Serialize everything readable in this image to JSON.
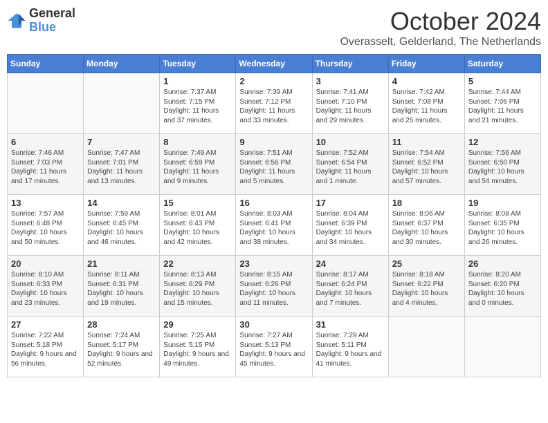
{
  "logo": {
    "general": "General",
    "blue": "Blue"
  },
  "title": "October 2024",
  "subtitle": "Overasselt, Gelderland, The Netherlands",
  "days_of_week": [
    "Sunday",
    "Monday",
    "Tuesday",
    "Wednesday",
    "Thursday",
    "Friday",
    "Saturday"
  ],
  "weeks": [
    [
      {
        "day": "",
        "content": ""
      },
      {
        "day": "",
        "content": ""
      },
      {
        "day": "1",
        "content": "Sunrise: 7:37 AM\nSunset: 7:15 PM\nDaylight: 11 hours and 37 minutes."
      },
      {
        "day": "2",
        "content": "Sunrise: 7:39 AM\nSunset: 7:12 PM\nDaylight: 11 hours and 33 minutes."
      },
      {
        "day": "3",
        "content": "Sunrise: 7:41 AM\nSunset: 7:10 PM\nDaylight: 11 hours and 29 minutes."
      },
      {
        "day": "4",
        "content": "Sunrise: 7:42 AM\nSunset: 7:08 PM\nDaylight: 11 hours and 25 minutes."
      },
      {
        "day": "5",
        "content": "Sunrise: 7:44 AM\nSunset: 7:06 PM\nDaylight: 11 hours and 21 minutes."
      }
    ],
    [
      {
        "day": "6",
        "content": "Sunrise: 7:46 AM\nSunset: 7:03 PM\nDaylight: 11 hours and 17 minutes."
      },
      {
        "day": "7",
        "content": "Sunrise: 7:47 AM\nSunset: 7:01 PM\nDaylight: 11 hours and 13 minutes."
      },
      {
        "day": "8",
        "content": "Sunrise: 7:49 AM\nSunset: 6:59 PM\nDaylight: 11 hours and 9 minutes."
      },
      {
        "day": "9",
        "content": "Sunrise: 7:51 AM\nSunset: 6:56 PM\nDaylight: 11 hours and 5 minutes."
      },
      {
        "day": "10",
        "content": "Sunrise: 7:52 AM\nSunset: 6:54 PM\nDaylight: 11 hours and 1 minute."
      },
      {
        "day": "11",
        "content": "Sunrise: 7:54 AM\nSunset: 6:52 PM\nDaylight: 10 hours and 57 minutes."
      },
      {
        "day": "12",
        "content": "Sunrise: 7:56 AM\nSunset: 6:50 PM\nDaylight: 10 hours and 54 minutes."
      }
    ],
    [
      {
        "day": "13",
        "content": "Sunrise: 7:57 AM\nSunset: 6:48 PM\nDaylight: 10 hours and 50 minutes."
      },
      {
        "day": "14",
        "content": "Sunrise: 7:59 AM\nSunset: 6:45 PM\nDaylight: 10 hours and 46 minutes."
      },
      {
        "day": "15",
        "content": "Sunrise: 8:01 AM\nSunset: 6:43 PM\nDaylight: 10 hours and 42 minutes."
      },
      {
        "day": "16",
        "content": "Sunrise: 8:03 AM\nSunset: 6:41 PM\nDaylight: 10 hours and 38 minutes."
      },
      {
        "day": "17",
        "content": "Sunrise: 8:04 AM\nSunset: 6:39 PM\nDaylight: 10 hours and 34 minutes."
      },
      {
        "day": "18",
        "content": "Sunrise: 8:06 AM\nSunset: 6:37 PM\nDaylight: 10 hours and 30 minutes."
      },
      {
        "day": "19",
        "content": "Sunrise: 8:08 AM\nSunset: 6:35 PM\nDaylight: 10 hours and 26 minutes."
      }
    ],
    [
      {
        "day": "20",
        "content": "Sunrise: 8:10 AM\nSunset: 6:33 PM\nDaylight: 10 hours and 23 minutes."
      },
      {
        "day": "21",
        "content": "Sunrise: 8:11 AM\nSunset: 6:31 PM\nDaylight: 10 hours and 19 minutes."
      },
      {
        "day": "22",
        "content": "Sunrise: 8:13 AM\nSunset: 6:29 PM\nDaylight: 10 hours and 15 minutes."
      },
      {
        "day": "23",
        "content": "Sunrise: 8:15 AM\nSunset: 6:26 PM\nDaylight: 10 hours and 11 minutes."
      },
      {
        "day": "24",
        "content": "Sunrise: 8:17 AM\nSunset: 6:24 PM\nDaylight: 10 hours and 7 minutes."
      },
      {
        "day": "25",
        "content": "Sunrise: 8:18 AM\nSunset: 6:22 PM\nDaylight: 10 hours and 4 minutes."
      },
      {
        "day": "26",
        "content": "Sunrise: 8:20 AM\nSunset: 6:20 PM\nDaylight: 10 hours and 0 minutes."
      }
    ],
    [
      {
        "day": "27",
        "content": "Sunrise: 7:22 AM\nSunset: 5:18 PM\nDaylight: 9 hours and 56 minutes."
      },
      {
        "day": "28",
        "content": "Sunrise: 7:24 AM\nSunset: 5:17 PM\nDaylight: 9 hours and 52 minutes."
      },
      {
        "day": "29",
        "content": "Sunrise: 7:25 AM\nSunset: 5:15 PM\nDaylight: 9 hours and 49 minutes."
      },
      {
        "day": "30",
        "content": "Sunrise: 7:27 AM\nSunset: 5:13 PM\nDaylight: 9 hours and 45 minutes."
      },
      {
        "day": "31",
        "content": "Sunrise: 7:29 AM\nSunset: 5:11 PM\nDaylight: 9 hours and 41 minutes."
      },
      {
        "day": "",
        "content": ""
      },
      {
        "day": "",
        "content": ""
      }
    ]
  ]
}
